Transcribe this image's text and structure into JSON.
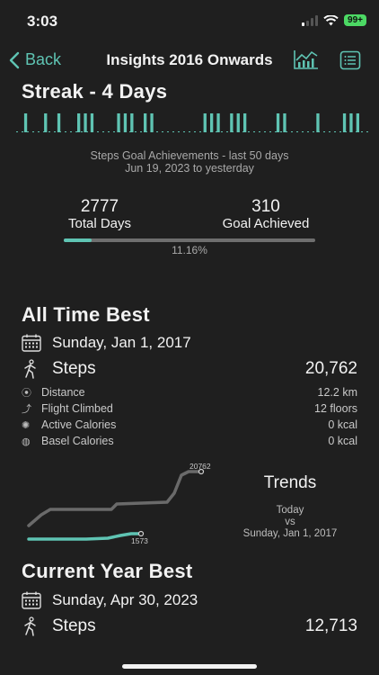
{
  "status": {
    "time": "3:03",
    "battery": "99+"
  },
  "nav": {
    "back_label": "Back",
    "title": "Insights 2016 Onwards"
  },
  "streak": {
    "title": "Streak - 4 Days",
    "days": [
      0,
      1,
      0,
      0,
      1,
      0,
      1,
      0,
      0,
      1,
      1,
      1,
      0,
      0,
      0,
      1,
      1,
      1,
      0,
      1,
      1,
      0,
      0,
      0,
      0,
      0,
      0,
      0,
      1,
      1,
      1,
      0,
      1,
      1,
      1,
      0,
      0,
      0,
      0,
      1,
      1,
      0,
      0,
      0,
      0,
      1,
      0,
      0,
      0,
      1,
      1,
      1,
      0
    ],
    "caption_line1": "Steps Goal Achievements - last 50 days",
    "caption_line2": "Jun 19, 2023 to yesterday"
  },
  "totals": {
    "total_days_value": "2777",
    "total_days_label": "Total Days",
    "goal_value": "310",
    "goal_label": "Goal Achieved",
    "percent_label": "11.16%",
    "progress_fraction": 0.1116
  },
  "all_time_best": {
    "title": "All Time Best",
    "date": "Sunday, Jan 1, 2017",
    "steps_label": "Steps",
    "steps_value": "20,762",
    "metrics": [
      {
        "label": "Distance",
        "value": "12.2 km"
      },
      {
        "label": "Flight Climbed",
        "value": "12 floors"
      },
      {
        "label": "Active Calories",
        "value": "0 kcal"
      },
      {
        "label": "Basel Calories",
        "value": "0 kcal"
      }
    ]
  },
  "trends": {
    "title": "Trends",
    "line1": "Today",
    "line2": "vs",
    "line3": "Sunday, Jan 1, 2017",
    "best_label": "20762",
    "today_label": "1573"
  },
  "current_year_best": {
    "title": "Current Year Best",
    "date": "Sunday, Apr 30, 2023",
    "steps_label": "Steps",
    "steps_value": "12,713"
  },
  "colors": {
    "accent": "#5fc4b3",
    "background": "#1f1f1f",
    "muted": "#6e6e6e"
  },
  "icons": [
    "chevron-left-icon",
    "chart-icon",
    "list-icon",
    "calendar-icon",
    "walker-icon"
  ]
}
